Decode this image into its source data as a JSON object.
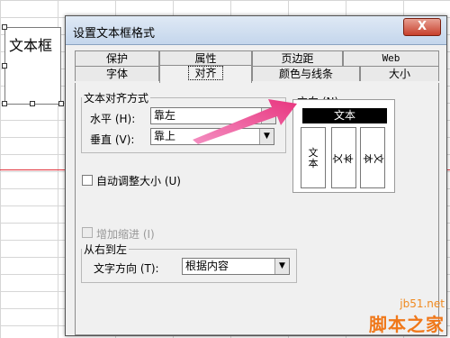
{
  "sheet": {
    "textbox_text": "文本框"
  },
  "dialog": {
    "title": "设置文本框格式",
    "close_label": "X",
    "tabs_back": [
      "保护",
      "属性",
      "页边距",
      "Web"
    ],
    "tabs_front": [
      "字体",
      "对齐",
      "颜色与线条",
      "大小"
    ],
    "active_tab": "对齐",
    "alignment": {
      "group_label": "文本对齐方式",
      "horizontal_label": "水平 (H):",
      "horizontal_value": "靠左",
      "vertical_label": "垂直 (V):",
      "vertical_value": "靠上"
    },
    "orientation": {
      "group_label": "方向 (N)",
      "selected_label": "文本",
      "option1": [
        "文",
        "本"
      ],
      "option2": [
        "文",
        "本"
      ],
      "option3": [
        "文",
        "本"
      ]
    },
    "autosize": {
      "label": "自动调整大小 (U)",
      "checked": false
    },
    "indent": {
      "label": "增加缩进 (I)",
      "enabled": false
    },
    "rtl": {
      "group_label": "从右到左",
      "direction_label": "文字方向 (T):",
      "direction_value": "根据内容"
    }
  },
  "watermark": {
    "url": "jb51.net",
    "name": "脚本之家"
  },
  "colors": {
    "accent_arrow": "#e8357e",
    "red_line": "#e0303a"
  }
}
